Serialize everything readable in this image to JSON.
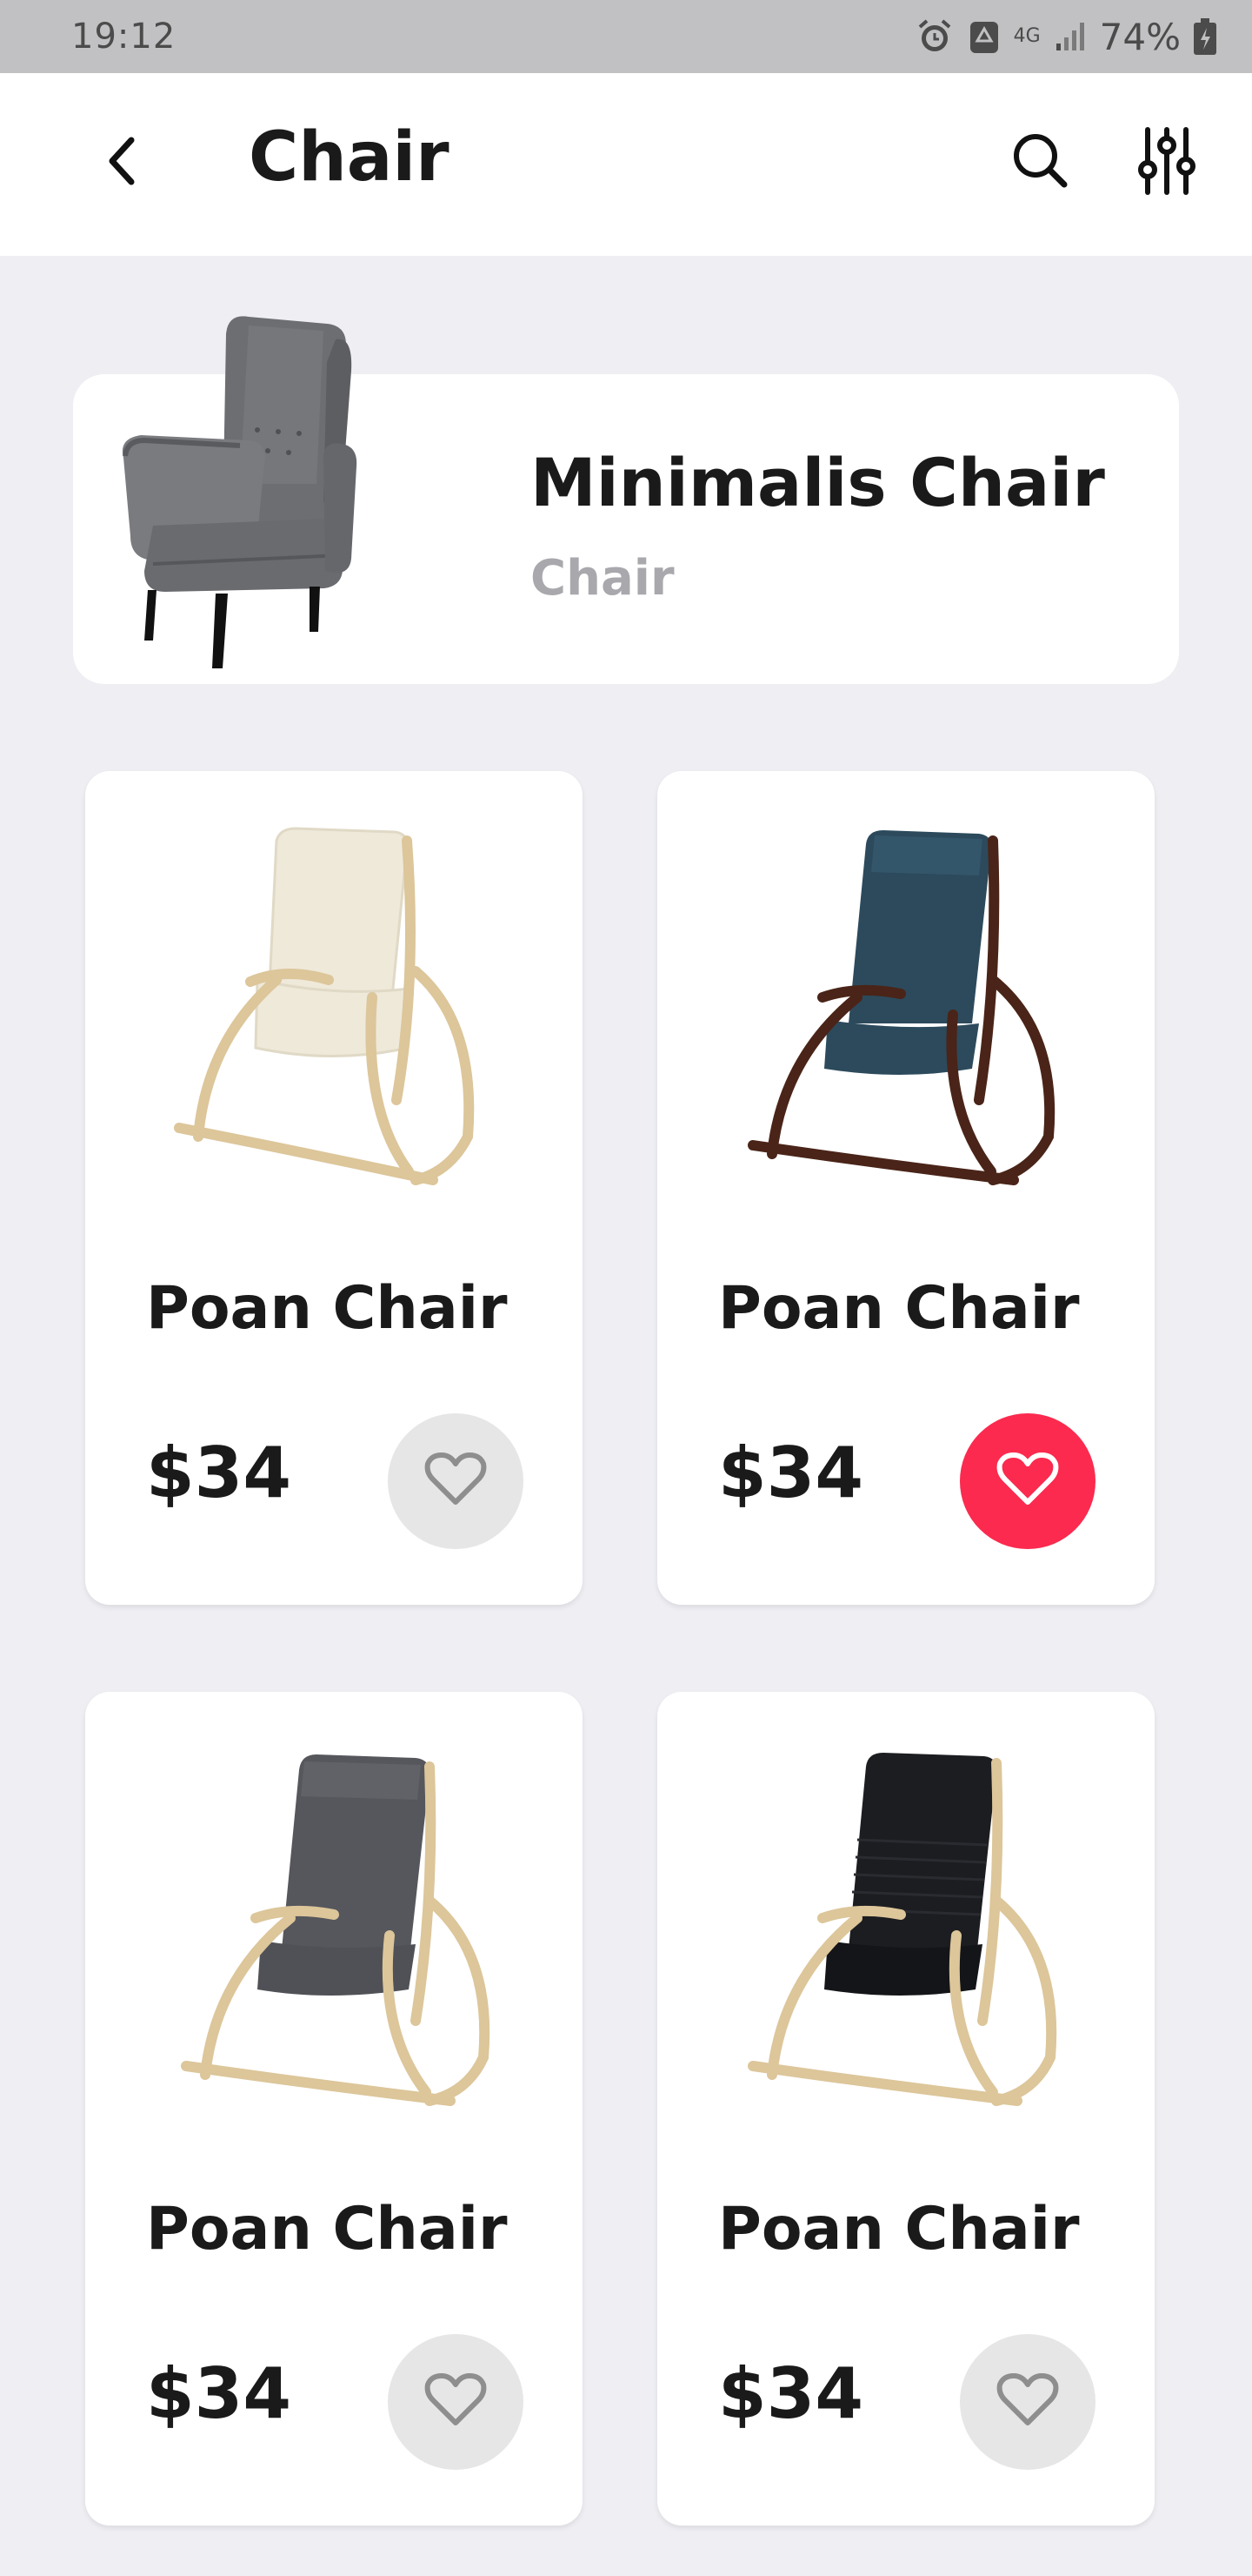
{
  "status_bar": {
    "time": "19:12",
    "network": "4G",
    "battery": "74%"
  },
  "app_bar": {
    "title": "Chair",
    "back_icon": "chevron-left-icon",
    "search_icon": "search-icon",
    "filter_icon": "filter-sliders-icon"
  },
  "featured": {
    "name": "Minimalis Chair",
    "category": "Chair",
    "image": "gray-wingback-armchair"
  },
  "products": [
    {
      "name": "Poan Chair",
      "price": "$34",
      "favorite": false,
      "image": "cream-rocking-chair",
      "cushion": "#efe9da",
      "frame": "#dcc69a"
    },
    {
      "name": "Poan Chair",
      "price": "$34",
      "favorite": true,
      "image": "blue-rocking-chair",
      "cushion": "#2c4a5c",
      "frame": "#4a2418"
    },
    {
      "name": "Poan Chair",
      "price": "$34",
      "favorite": false,
      "image": "gray-rocking-chair",
      "cushion": "#55575c",
      "frame": "#dcc69a"
    },
    {
      "name": "Poan Chair",
      "price": "$34",
      "favorite": false,
      "image": "black-rocking-chair",
      "cushion": "#1c1d21",
      "frame": "#dcc69a"
    }
  ],
  "colors": {
    "background": "#eeeef3",
    "card": "#ffffff",
    "favorite_active": "#fb2a4e",
    "favorite_inactive": "#e6e6e6",
    "heart_inactive": "#8e8e8e"
  }
}
